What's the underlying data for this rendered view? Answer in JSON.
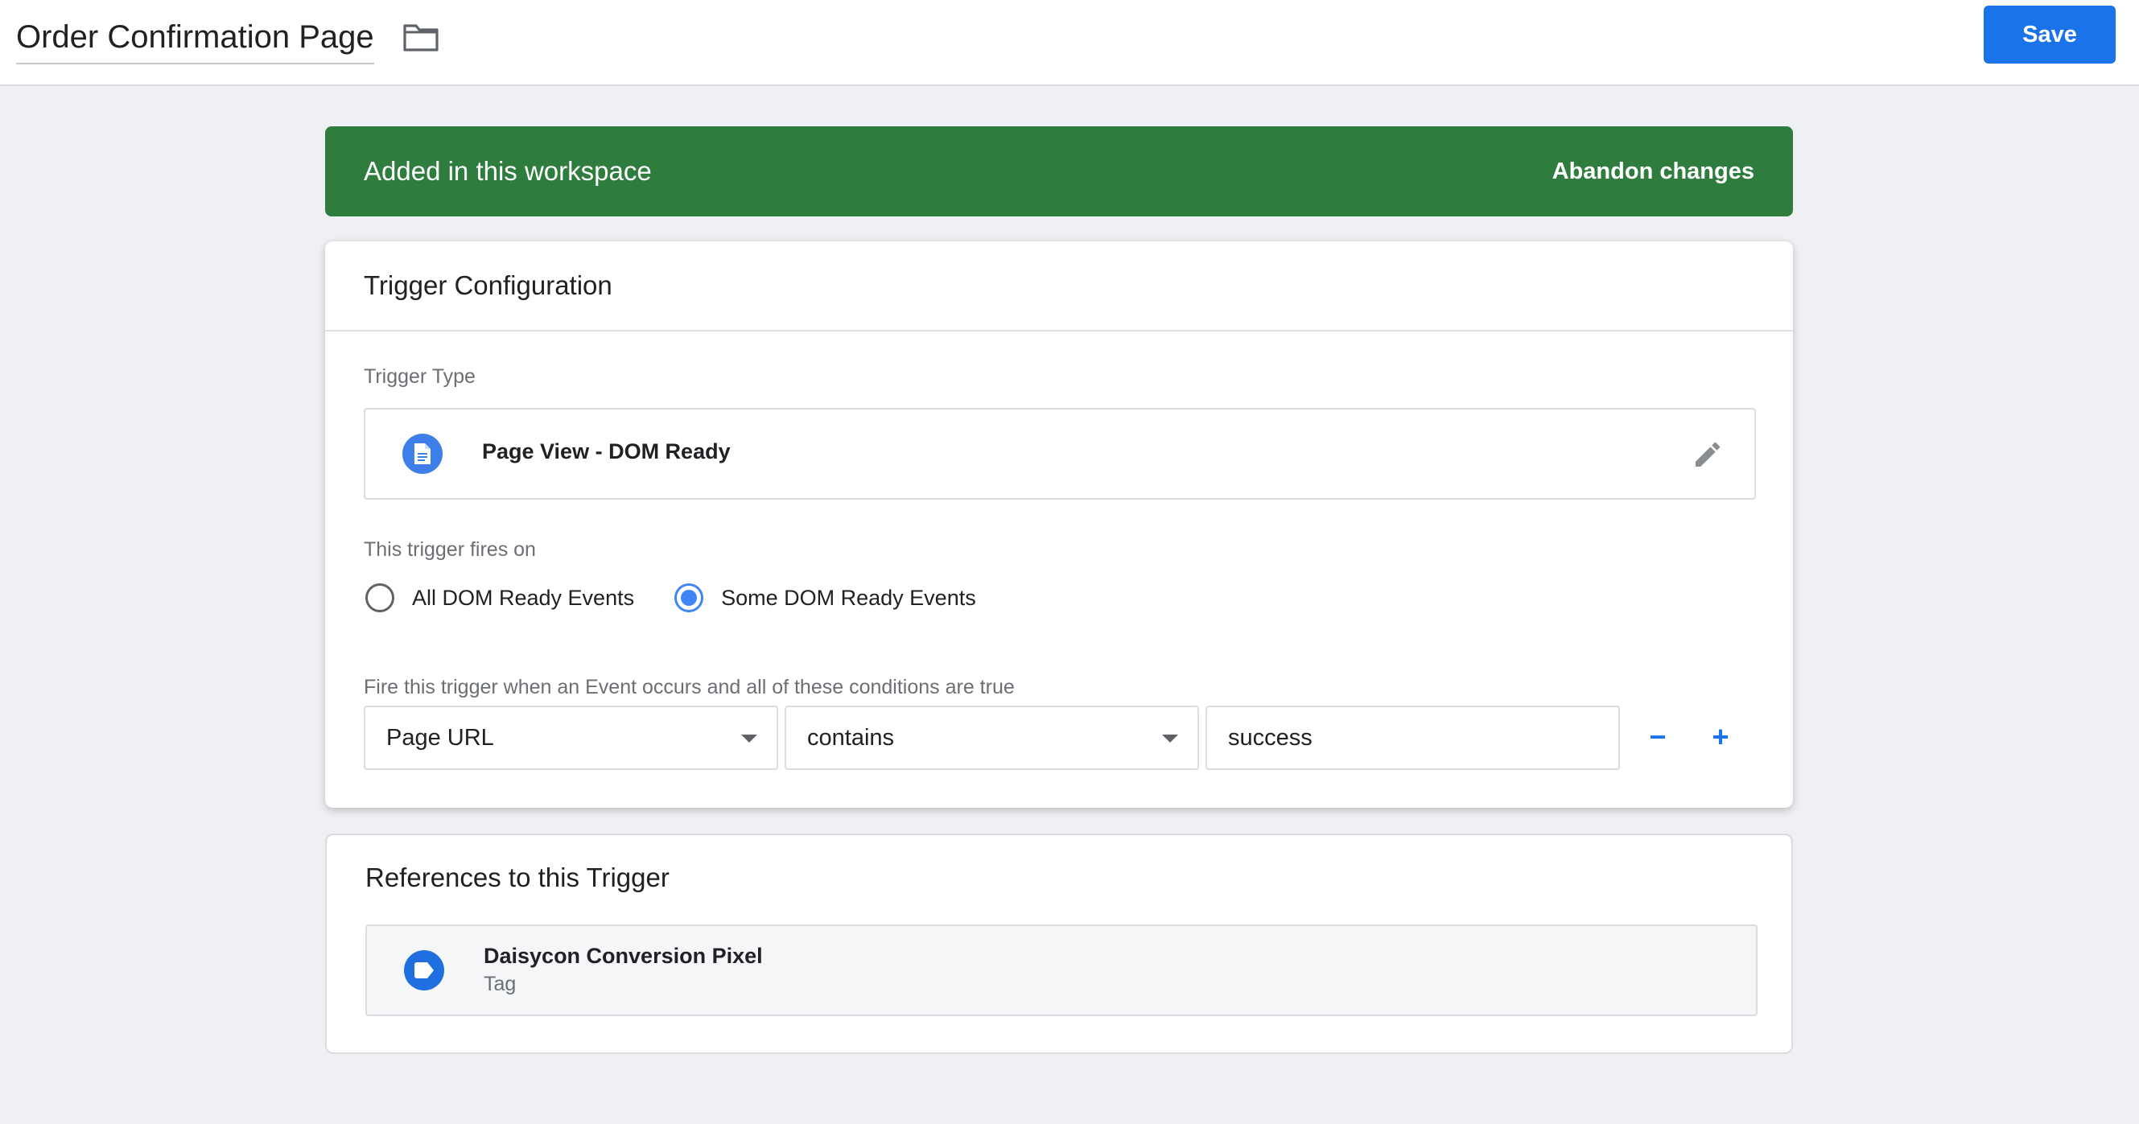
{
  "header": {
    "title": "Order Confirmation Page",
    "save_label": "Save"
  },
  "banner": {
    "text": "Added in this workspace",
    "action_label": "Abandon changes",
    "color": "#2f7d3e"
  },
  "trigger_config": {
    "heading": "Trigger Configuration",
    "type_label": "Trigger Type",
    "type_name": "Page View - DOM Ready",
    "type_icon": "document-icon",
    "fires_on_label": "This trigger fires on",
    "fires_on_options": [
      {
        "label": "All DOM Ready Events",
        "selected": false
      },
      {
        "label": "Some DOM Ready Events",
        "selected": true
      }
    ],
    "condition_label": "Fire this trigger when an Event occurs and all of these conditions are true",
    "condition": {
      "variable": "Page URL",
      "operator": "contains",
      "value": "success"
    },
    "remove_label": "−",
    "add_label": "+"
  },
  "references": {
    "heading": "References to this Trigger",
    "items": [
      {
        "name": "Daisycon Conversion Pixel",
        "type": "Tag",
        "icon": "tag-icon"
      }
    ]
  },
  "colors": {
    "accent": "#1a73e8",
    "radio": "#4285f4"
  }
}
